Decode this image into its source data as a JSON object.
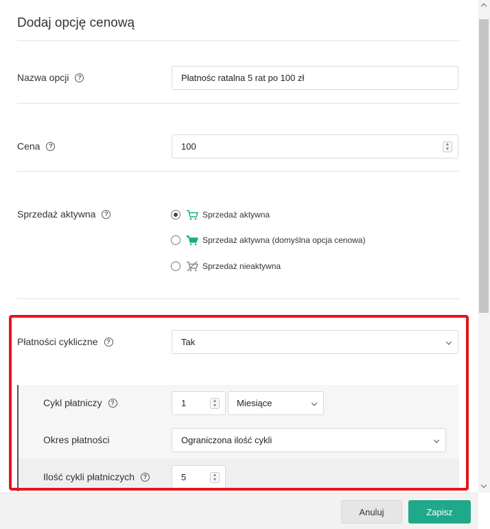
{
  "dialog": {
    "title": "Dodaj opcję cenową"
  },
  "fields": {
    "option_name": {
      "label": "Nazwa opcji",
      "value": "Płatnośc ratalna 5 rat po 100 zł"
    },
    "price": {
      "label": "Cena",
      "value": "100"
    },
    "sale_active": {
      "label": "Sprzedaż aktywna",
      "options": [
        {
          "label": "Sprzedaż aktywna",
          "checked": true,
          "icon": "cart-icon"
        },
        {
          "label": "Sprzedaż aktywna (domyślna opcja cenowa)",
          "checked": false,
          "icon": "cart-filled-icon"
        },
        {
          "label": "Sprzedaż nieaktywna",
          "checked": false,
          "icon": "cart-disabled-icon"
        }
      ]
    },
    "recurring": {
      "label": "Płatności cykliczne",
      "value": "Tak"
    },
    "cycle": {
      "label": "Cykl płatniczy",
      "value": "1",
      "unit": "Miesiące"
    },
    "period": {
      "label": "Okres płatności",
      "value": "Ograniczona ilość cykli"
    },
    "cycles_count": {
      "label": "Ilość cykli płatniczych",
      "value": "5"
    }
  },
  "footer": {
    "cancel_label": "Anuluj",
    "save_label": "Zapisz"
  },
  "colors": {
    "accent": "#1fa98a",
    "highlight_frame": "#e8131a"
  }
}
